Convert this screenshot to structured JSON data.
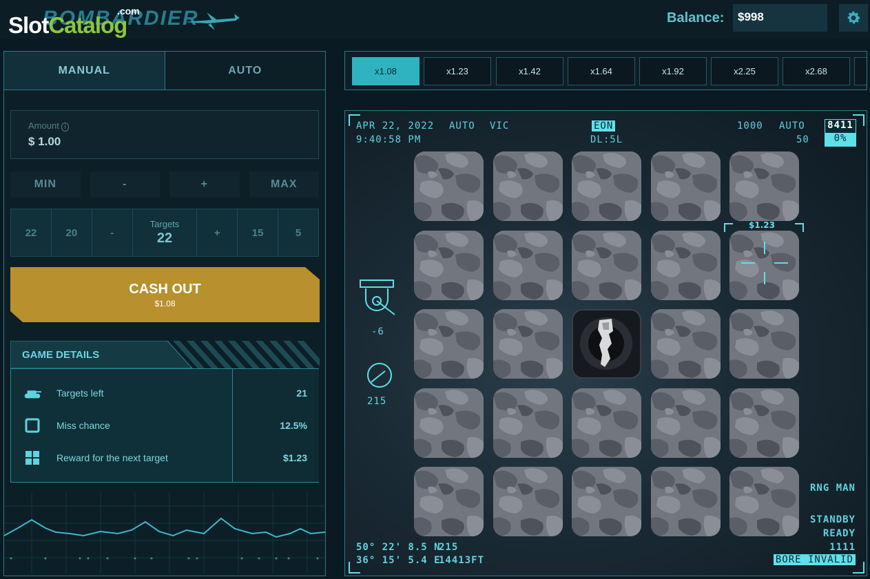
{
  "header": {
    "logo_slot": "Slot",
    "logo_catalog": "Catalog",
    "logo_com": ".com",
    "game_logo": "BOMBARDIER",
    "balance_label": "Balance:",
    "balance_value": "$998",
    "settings_icon": "gear-icon"
  },
  "tabs": [
    {
      "label": "MANUAL",
      "active": true
    },
    {
      "label": "AUTO",
      "active": false
    }
  ],
  "amount": {
    "label": "Amount",
    "info_icon": "info-icon",
    "value": "$ 1.00"
  },
  "bet_buttons": [
    "MIN",
    "-",
    "+",
    "MAX"
  ],
  "targets": {
    "label": "Targets",
    "value": "22",
    "options": [
      "22",
      "20",
      "-",
      "+",
      "15",
      "5"
    ]
  },
  "cashout": {
    "label": "CASH OUT",
    "amount": "$1.08",
    "color": "#b8902e"
  },
  "game_details": {
    "title": "GAME DETAILS",
    "rows": [
      {
        "icon": "tank-icon",
        "label": "Targets left",
        "value": "21"
      },
      {
        "icon": "square-icon",
        "label": "Miss chance",
        "value": "12.5%"
      },
      {
        "icon": "grid-icon",
        "label": "Reward for the next target",
        "value": "$1.23"
      }
    ]
  },
  "multipliers": [
    "x1.08",
    "x1.23",
    "x1.42",
    "x1.64",
    "x1.92",
    "x2.25",
    "x2.68"
  ],
  "active_multiplier": 0,
  "hud": {
    "date": "APR 22, 2022",
    "time": "9:40:58 PM",
    "auto": "AUTO",
    "vic": "VIC",
    "eon": "EON",
    "dl": "DL:5L",
    "n1000": "1000",
    "auto2": "AUTO",
    "n50": "50",
    "n8411": "8411",
    "pct": "0%",
    "gauge1": "-6",
    "gauge2": "215",
    "lat": "50° 22' 8.5 N",
    "lat_val": "215",
    "lon": "36° 15' 5.4 E",
    "lon_val": "14413FT",
    "rng": "RNG MAN",
    "standby": "STANDBY",
    "ready": "READY",
    "n1111": "1111",
    "bore": "BORE INVALID",
    "target_price": "$1.23"
  },
  "grid": {
    "rows": 5,
    "cols": 5,
    "revealed_cell": [
      2,
      2
    ],
    "target_cell": [
      1,
      4
    ]
  },
  "colors": {
    "accent": "#5fe0ea",
    "cashout": "#b8902e",
    "panel_border": "#2b7a86"
  }
}
